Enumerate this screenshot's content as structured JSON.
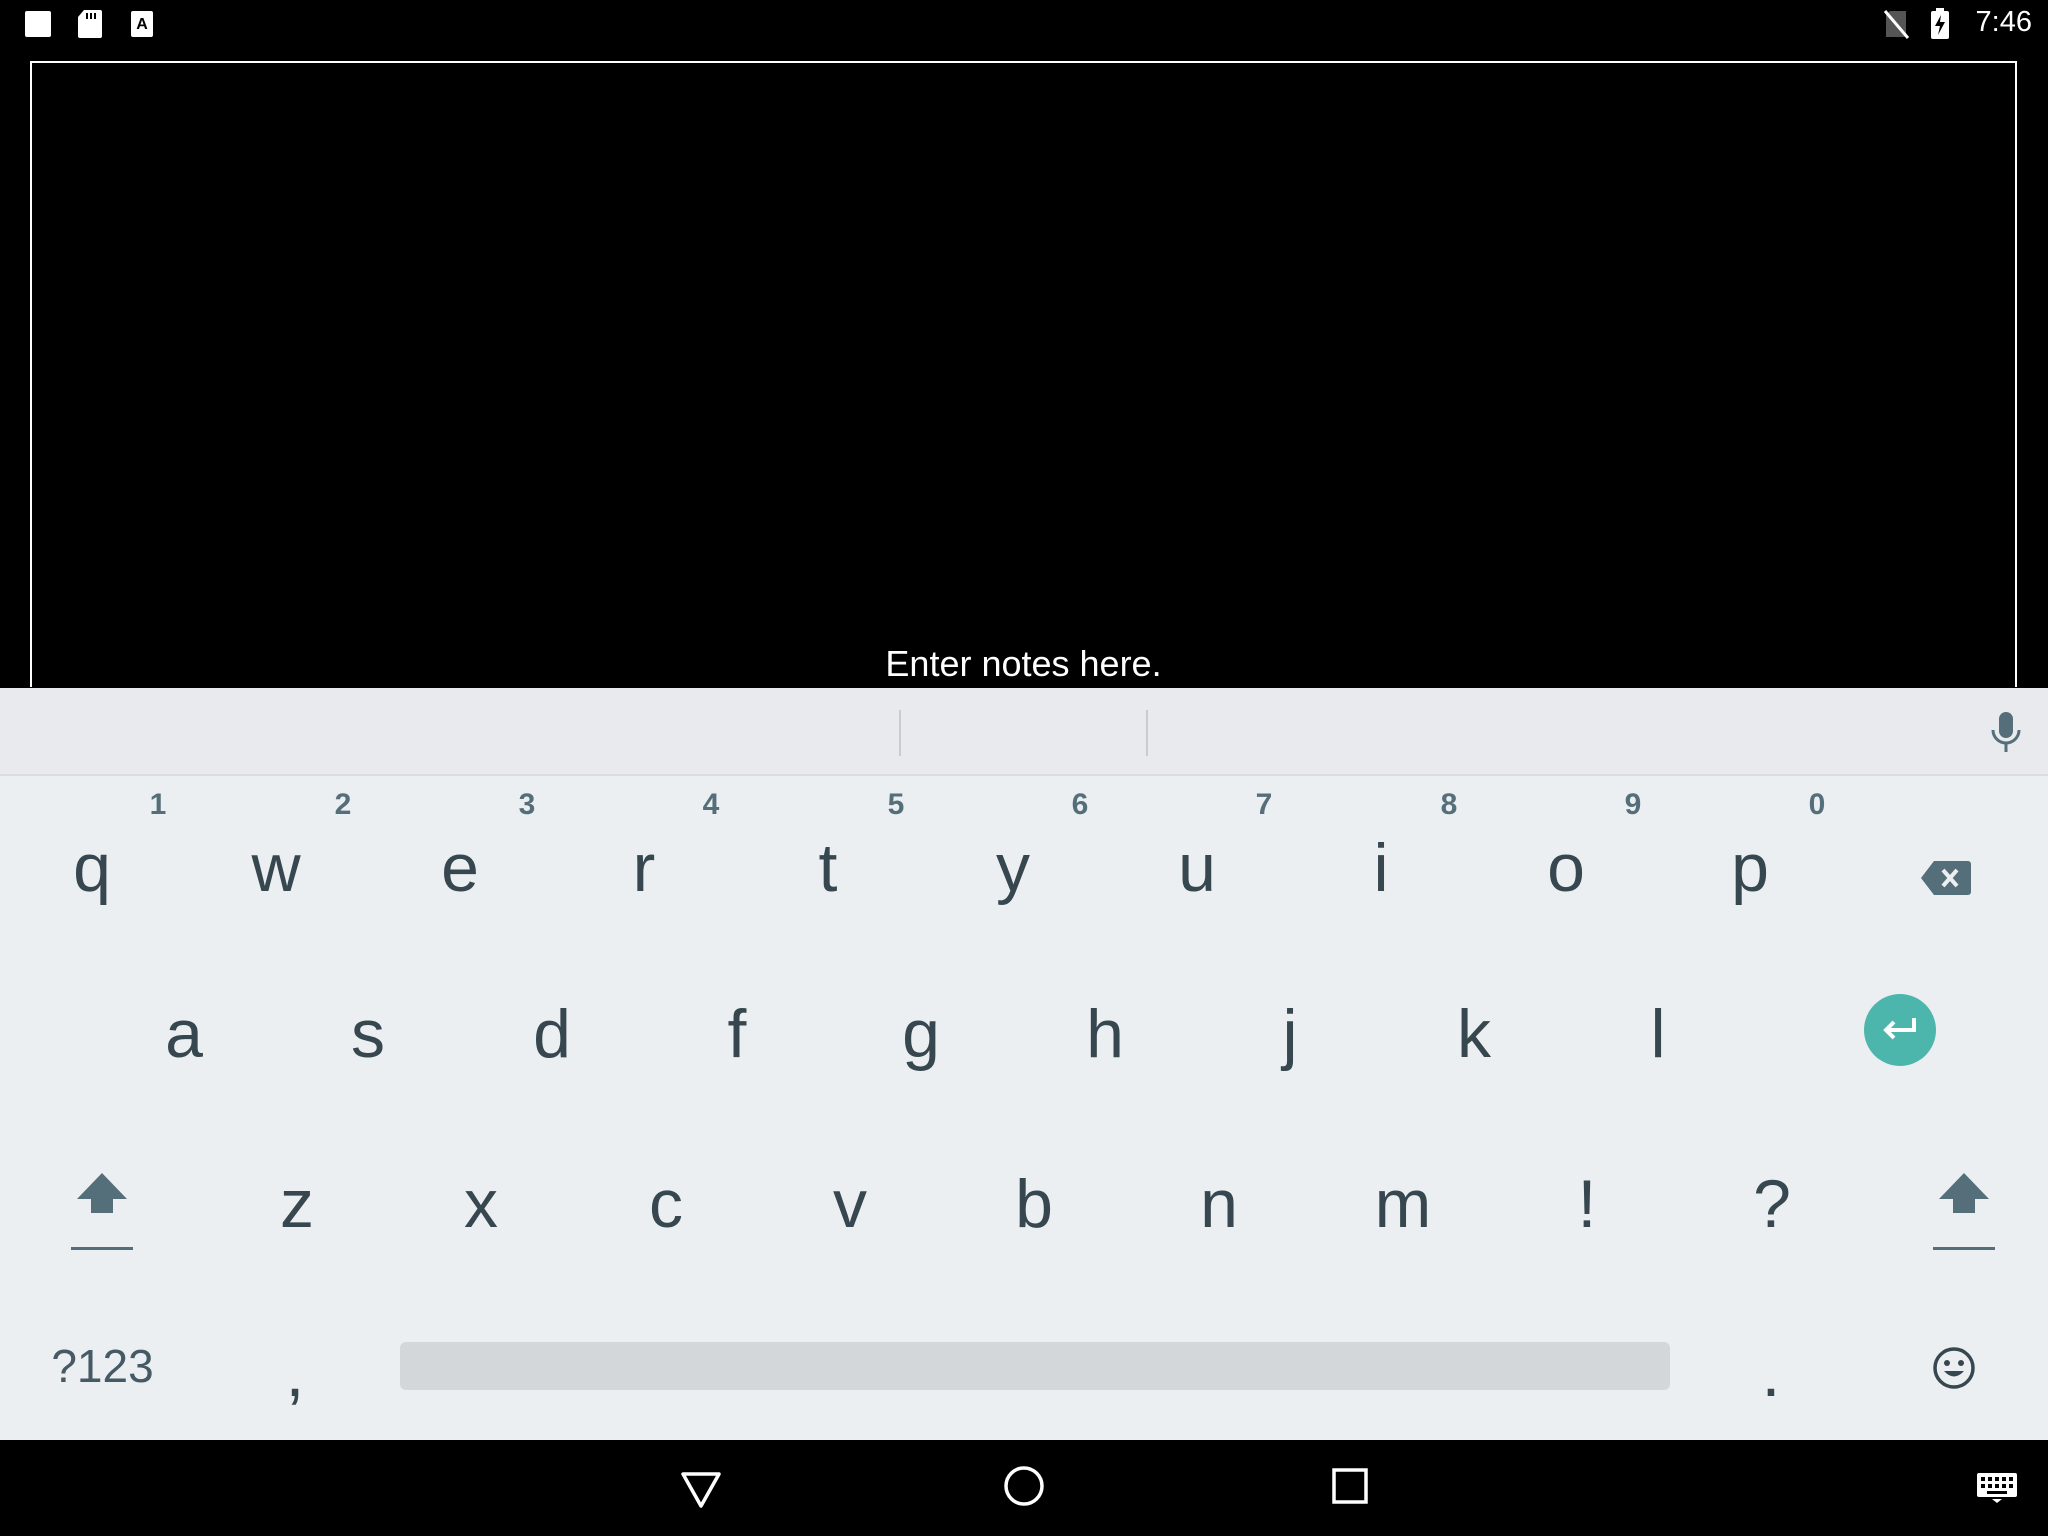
{
  "status_bar": {
    "time": "7:46",
    "left_icons": [
      "notification-square-icon",
      "sd-card-icon",
      "keyboard-a-icon"
    ],
    "right_icons": [
      "no-sim-icon",
      "battery-charging-icon"
    ]
  },
  "notes": {
    "placeholder": "Enter notes here."
  },
  "keyboard": {
    "row1": [
      {
        "label": "q",
        "hint": "1"
      },
      {
        "label": "w",
        "hint": "2"
      },
      {
        "label": "e",
        "hint": "3"
      },
      {
        "label": "r",
        "hint": "4"
      },
      {
        "label": "t",
        "hint": "5"
      },
      {
        "label": "y",
        "hint": "6"
      },
      {
        "label": "u",
        "hint": "7"
      },
      {
        "label": "i",
        "hint": "8"
      },
      {
        "label": "o",
        "hint": "9"
      },
      {
        "label": "p",
        "hint": "0"
      }
    ],
    "row2": [
      "a",
      "s",
      "d",
      "f",
      "g",
      "h",
      "j",
      "k",
      "l"
    ],
    "row3": [
      "z",
      "x",
      "c",
      "v",
      "b",
      "n",
      "m",
      "!",
      "?"
    ],
    "symbols_key": "?123",
    "comma_key": ",",
    "period_key": ".",
    "accent_color": "#4db6ac"
  },
  "nav_bar": {
    "icons": [
      "back-icon",
      "home-icon",
      "recents-icon",
      "keyboard-switch-icon"
    ]
  }
}
